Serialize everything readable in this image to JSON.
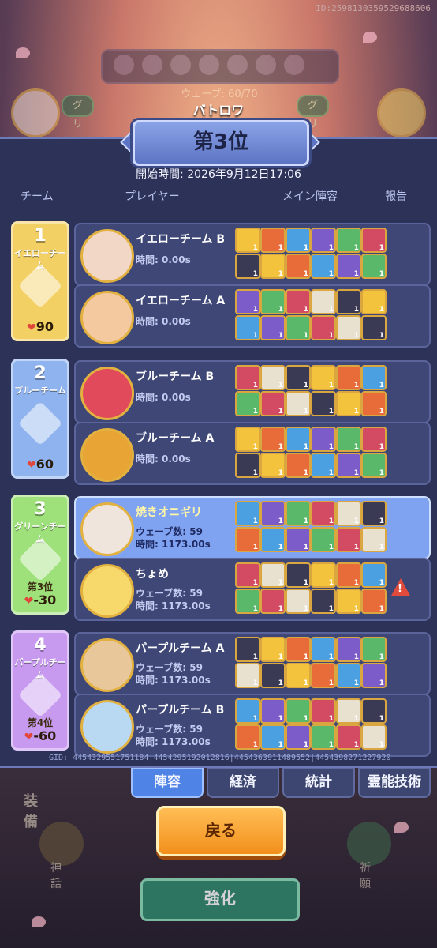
{
  "topId": "ID:2598130359529688606",
  "bgUi": {
    "waveLabel": "ウェーブ: 60/70",
    "teamLeft": "グリーンチー",
    "teamRight": "グリーンチー",
    "equip": "装備",
    "mythic": "神話",
    "prayer": "祈願",
    "enhance": "強化"
  },
  "mode": "バトロワ",
  "title": "第3位",
  "startTime": "開始時間:  2026年9月12日17:06",
  "headers": {
    "team": "チーム",
    "player": "プレイヤー",
    "lineup": "メイン陣容",
    "report": "報告"
  },
  "teams": [
    {
      "rank": "1",
      "name": "イエローチーム",
      "hp": "90",
      "place": "",
      "color": "#f3d064",
      "players": [
        {
          "name": "イエローチーム B",
          "time": "時間:  0.00s",
          "wave": "",
          "me": false,
          "warn": false
        },
        {
          "name": "イエローチーム A",
          "time": "時間:  0.00s",
          "wave": "",
          "me": false,
          "warn": false
        }
      ]
    },
    {
      "rank": "2",
      "name": "ブルーチーム",
      "hp": "60",
      "place": "",
      "color": "#8fb3ee",
      "players": [
        {
          "name": "ブルーチーム B",
          "time": "時間:  0.00s",
          "wave": "",
          "me": false,
          "warn": false
        },
        {
          "name": "ブルーチーム A",
          "time": "時間:  0.00s",
          "wave": "",
          "me": false,
          "warn": false
        }
      ]
    },
    {
      "rank": "3",
      "name": "グリーンチーム",
      "hp": "-30",
      "place": "第3位",
      "color": "#9ee07a",
      "players": [
        {
          "name": "焼きオニギリ",
          "time": "時間:  1173.00s",
          "wave": "ウェーブ数:  59",
          "me": true,
          "warn": false
        },
        {
          "name": "ちょめ",
          "time": "時間:  1173.00s",
          "wave": "ウェーブ数:  59",
          "me": false,
          "warn": true
        }
      ]
    },
    {
      "rank": "4",
      "name": "パープルチーム",
      "hp": "-60",
      "place": "第4位",
      "color": "#c79af0",
      "players": [
        {
          "name": "パープルチーム A",
          "time": "時間:  1173.00s",
          "wave": "ウェーブ数:  59",
          "me": false,
          "warn": false
        },
        {
          "name": "パープルチーム B",
          "time": "時間:  1173.00s",
          "wave": "ウェーブ数:  59",
          "me": false,
          "warn": false
        }
      ]
    }
  ],
  "gid": "GID: 4454329551751184|4454295192012816|4454363911489552|4454398271227920",
  "tabs": [
    "陣容",
    "経済",
    "統計",
    "霊能技術"
  ],
  "backLabel": "戻る",
  "unitLevel": "1"
}
